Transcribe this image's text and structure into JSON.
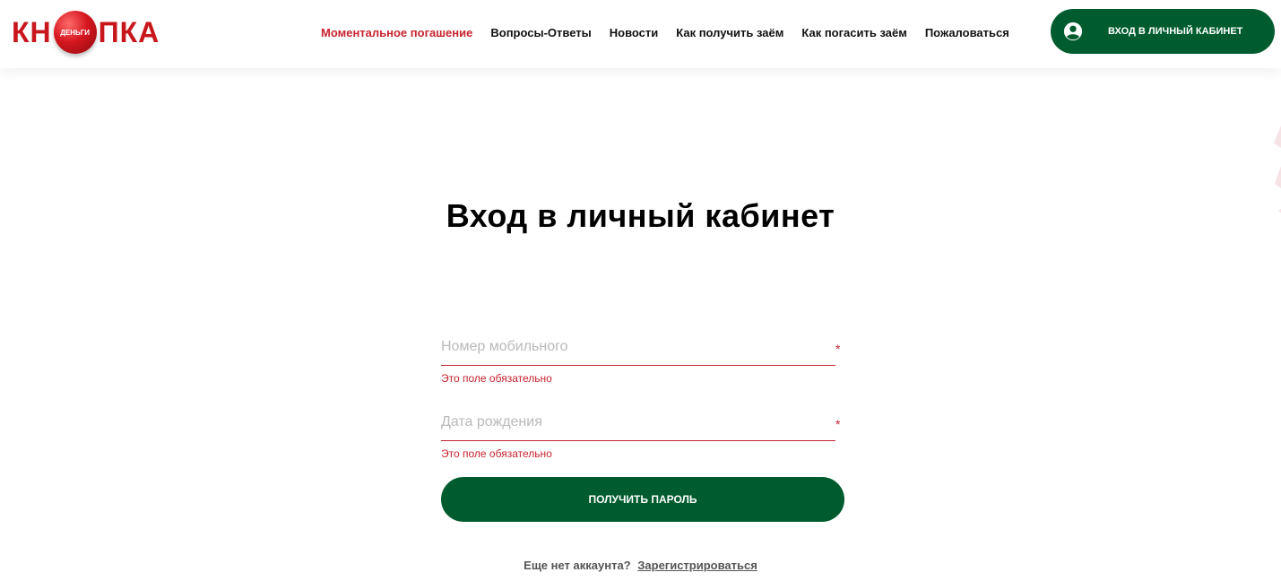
{
  "header": {
    "logo": {
      "left": "КН",
      "ball_text": "ДЕНЬГИ",
      "right": "ПКА"
    },
    "nav": [
      {
        "label": "Моментальное погашение",
        "active": true
      },
      {
        "label": "Вопросы-Ответы"
      },
      {
        "label": "Новости"
      },
      {
        "label": "Как получить заём"
      },
      {
        "label": "Как погасить заём"
      },
      {
        "label": "Пожаловаться"
      }
    ],
    "login_button": "ВХОД В ЛИЧНЫЙ КАБИНЕТ"
  },
  "main": {
    "title": "Вход в личный кабинет",
    "fields": [
      {
        "placeholder": "Номер мобильного",
        "value": "",
        "required_mark": "*",
        "error": "Это поле обязательно"
      },
      {
        "placeholder": "Дата рождения",
        "value": "",
        "required_mark": "*",
        "error": "Это поле обязательно"
      }
    ],
    "submit_button": "ПОЛУЧИТЬ ПАРОЛЬ",
    "register_prompt": "Еще нет аккаунта?",
    "register_link": "Зарегистрироваться"
  },
  "colors": {
    "brand_green": "#005c2f",
    "brand_red": "#c8232f",
    "placeholder_gray": "#b9b9b9"
  }
}
